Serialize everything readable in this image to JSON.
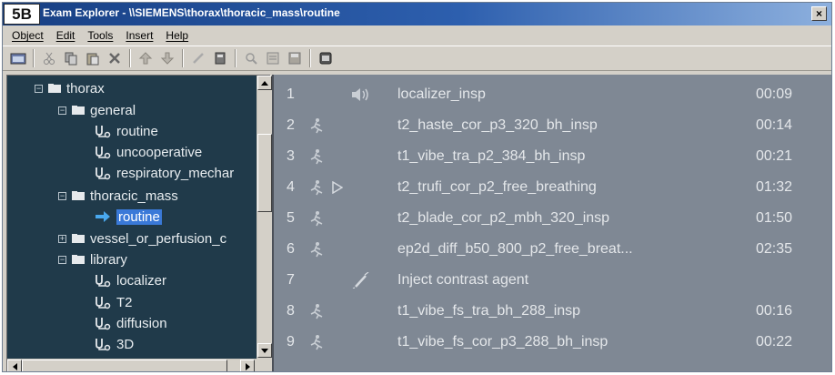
{
  "figure_label": "5B",
  "window": {
    "title": "Exam Explorer - \\\\SIEMENS\\thorax\\thoracic_mass\\routine",
    "close_glyph": "×"
  },
  "menu": [
    {
      "label": "Object"
    },
    {
      "label": "Edit"
    },
    {
      "label": "Tools"
    },
    {
      "label": "Insert"
    },
    {
      "label": "Help"
    }
  ],
  "toolbar": {
    "icons": [
      "open-icon",
      "cut-icon",
      "copy-icon",
      "paste-icon",
      "delete-icon",
      "move-up-icon",
      "move-down-icon",
      "edit-icon",
      "properties-icon",
      "search-icon",
      "report-icon",
      "save-icon",
      "options-icon"
    ]
  },
  "tree": {
    "items": [
      {
        "label": "thorax",
        "type": "folder",
        "expanded": true
      },
      {
        "label": "general",
        "type": "folder",
        "expanded": true
      },
      {
        "label": "routine",
        "type": "protocol"
      },
      {
        "label": "uncooperative",
        "type": "protocol"
      },
      {
        "label": "respiratory_mechar",
        "type": "protocol"
      },
      {
        "label": "thoracic_mass",
        "type": "folder",
        "expanded": true
      },
      {
        "label": "routine",
        "type": "selected"
      },
      {
        "label": "vessel_or_perfusion_c",
        "type": "folder",
        "expanded": false
      },
      {
        "label": "library",
        "type": "folder",
        "expanded": true
      },
      {
        "label": "localizer",
        "type": "protocol"
      },
      {
        "label": "T2",
        "type": "protocol"
      },
      {
        "label": "diffusion",
        "type": "protocol"
      },
      {
        "label": "3D",
        "type": "protocol"
      }
    ]
  },
  "list": {
    "rows": [
      {
        "num": "1",
        "icon": "speaker-icon",
        "name": "localizer_insp",
        "time": "00:09"
      },
      {
        "num": "2",
        "icon": "breath-hold-icon",
        "name": "t2_haste_cor_p3_320_bh_insp",
        "time": "00:14"
      },
      {
        "num": "3",
        "icon": "breath-hold-icon",
        "name": "t1_vibe_tra_p2_384_bh_insp",
        "time": "00:21"
      },
      {
        "num": "4",
        "icon": "breath-hold-icon",
        "play": true,
        "name": "t2_trufi_cor_p2_free_breathing",
        "time": "01:32"
      },
      {
        "num": "5",
        "icon": "breath-hold-icon",
        "name": "t2_blade_cor_p2_mbh_320_insp",
        "time": "01:50"
      },
      {
        "num": "6",
        "icon": "breath-hold-icon",
        "name": "ep2d_diff_b50_800_p2_free_breat...",
        "time": "02:35"
      },
      {
        "num": "7",
        "icon": "syringe-icon",
        "name": "Inject contrast agent",
        "time": ""
      },
      {
        "num": "8",
        "icon": "breath-hold-icon",
        "name": "t1_vibe_fs_tra_bh_288_insp",
        "time": "00:16"
      },
      {
        "num": "9",
        "icon": "breath-hold-icon",
        "name": "t1_vibe_fs_cor_p3_288_bh_insp",
        "time": "00:22"
      }
    ]
  }
}
